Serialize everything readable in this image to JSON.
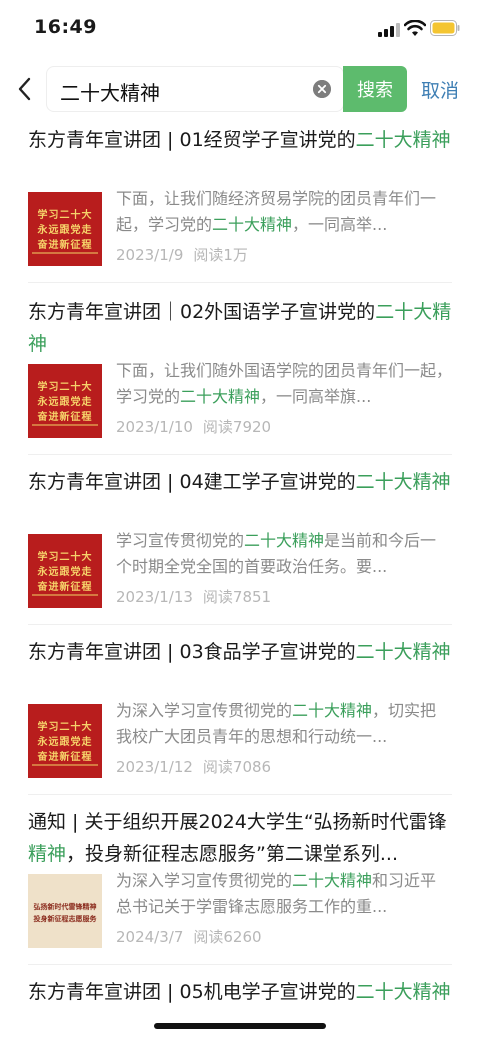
{
  "status": {
    "time": "16:49"
  },
  "search": {
    "query": "二十大精神",
    "button": "搜索",
    "cancel": "取消"
  },
  "thumb_text": {
    "red": [
      "学习二十大",
      "永远跟党走",
      "奋进新征程"
    ],
    "cream": [
      "弘扬新时代雷锋精神",
      "投身新征程志愿服务"
    ]
  },
  "results": [
    {
      "title_pre": "东方青年宣讲团 | 01经贸学子宣讲党的",
      "title_hl": "二十大精神",
      "title_post": "",
      "snippet_pre": "下面，让我们随经济贸易学院的团员青年们一起，学习党的",
      "snippet_hl": "二十大精神",
      "snippet_post": "，一同高举...",
      "date": "2023/1/9",
      "reads": "阅读1万",
      "thumb": "red"
    },
    {
      "title_pre": "东方青年宣讲团｜02外国语学子宣讲党的",
      "title_hl": "二十大精神",
      "title_post": "",
      "snippet_pre": "下面，让我们随外国语学院的团员青年们一起，学习党的",
      "snippet_hl": "二十大精神",
      "snippet_post": "，一同高举旗...",
      "date": "2023/1/10",
      "reads": "阅读7920",
      "thumb": "red"
    },
    {
      "title_pre": "东方青年宣讲团 | 04建工学子宣讲党的",
      "title_hl": "二十大精神",
      "title_post": "",
      "snippet_pre": "学习宣传贯彻党的",
      "snippet_hl": "二十大精神",
      "snippet_post": "是当前和今后一个时期全党全国的首要政治任务。要...",
      "date": "2023/1/13",
      "reads": "阅读7851",
      "thumb": "red"
    },
    {
      "title_pre": "东方青年宣讲团 | 03食品学子宣讲党的",
      "title_hl": "二十大精神",
      "title_post": "",
      "snippet_pre": "为深入学习宣传贯彻党的",
      "snippet_hl": "二十大精神",
      "snippet_post": "，切实把我校广大团员青年的思想和行动统一...",
      "date": "2023/1/12",
      "reads": "阅读7086",
      "thumb": "red"
    },
    {
      "title_pre": "通知 | 关于组织开展2024大学生“弘扬新时代雷锋",
      "title_hl": "精神",
      "title_post": "，投身新征程志愿服务”第二课堂系列...",
      "snippet_pre": "为深入学习宣传贯彻党的",
      "snippet_hl": "二十大精神",
      "snippet_post": "和习近平总书记关于学雷锋志愿服务工作的重...",
      "date": "2024/3/7",
      "reads": "阅读6260",
      "thumb": "cream"
    },
    {
      "title_pre": "东方青年宣讲团 | 05机电学子宣讲党的",
      "title_hl": "二十大精神",
      "title_post": ""
    }
  ]
}
